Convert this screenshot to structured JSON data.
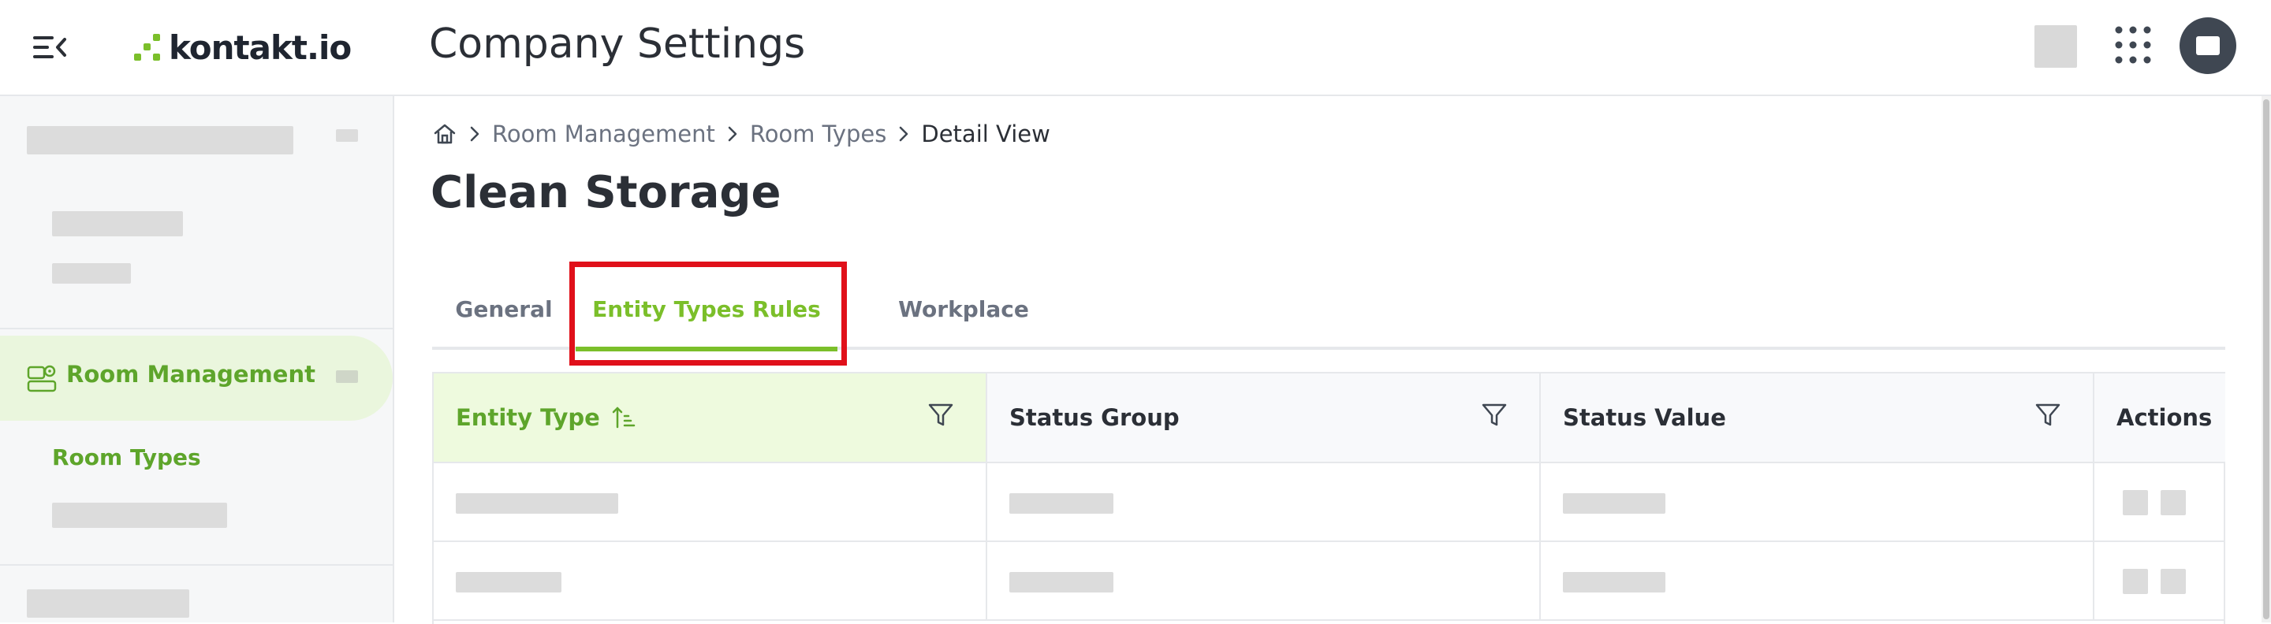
{
  "header": {
    "logo_text": "kontakt.io",
    "app_title": "Company Settings",
    "menu_icon": "menu-collapse-icon",
    "apps_icon": "grid-dots-icon"
  },
  "sidebar": {
    "active_item": {
      "label": "Room Management",
      "icon": "room-management-icon"
    },
    "active_subitem": {
      "label": "Room Types"
    }
  },
  "breadcrumb": {
    "home_icon": "home-icon",
    "items": [
      "Room Management",
      "Room Types",
      "Detail View"
    ]
  },
  "page": {
    "title": "Clean Storage"
  },
  "tabs": [
    {
      "label": "General"
    },
    {
      "label": "Entity Types Rules",
      "active": true
    },
    {
      "label": "Workplace"
    }
  ],
  "table": {
    "columns": [
      {
        "label": "Entity Type",
        "sorted": "ascending",
        "filter_icon": "filter-icon"
      },
      {
        "label": "Status Group",
        "filter_icon": "filter-icon"
      },
      {
        "label": "Status Value",
        "filter_icon": "filter-icon"
      },
      {
        "label": "Actions"
      }
    ]
  },
  "colors": {
    "accent": "#7bbf2a",
    "accent_text": "#5ea52b",
    "highlight": "#e0101a",
    "active_bg": "#eaf6dd"
  }
}
